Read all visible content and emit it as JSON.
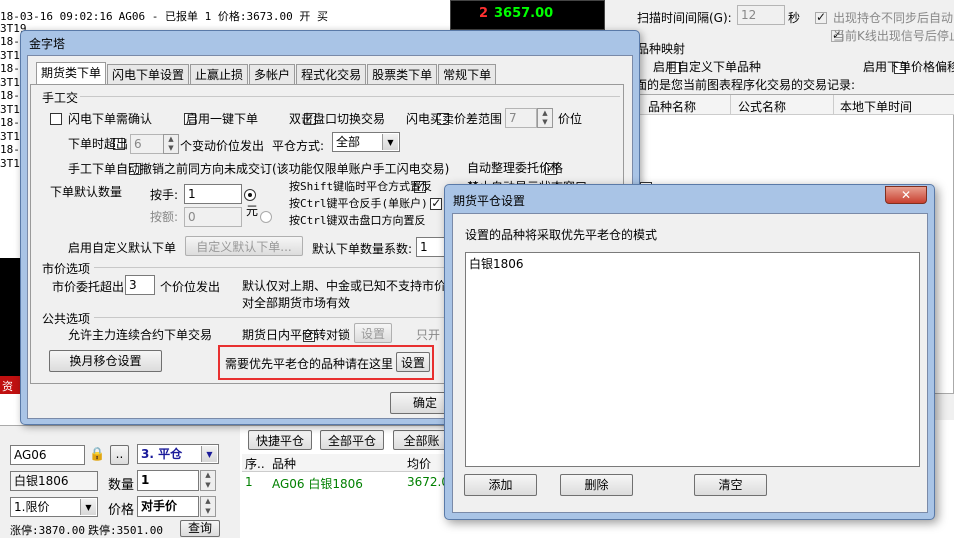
{
  "background_app": {
    "log_lines": [
      {
        "prefix": "18-03-16 09:02:16",
        "text": "AG06 - 已报单 1 价格:3673.00 开 买"
      },
      {
        "prefix": "3T19",
        "text": ""
      },
      {
        "prefix": "18-0",
        "text": ""
      },
      {
        "prefix": "3T19",
        "text": ""
      },
      {
        "prefix": "18-0",
        "text": ""
      },
      {
        "prefix": "3T19",
        "text": ""
      },
      {
        "prefix": "18-0",
        "text": ""
      },
      {
        "prefix": "3T19",
        "text": ""
      },
      {
        "prefix": "18-0",
        "text": ""
      },
      {
        "prefix": "3T19",
        "text": ""
      },
      {
        "prefix": "18-0",
        "text": ""
      },
      {
        "prefix": "3T19",
        "text": ""
      }
    ],
    "quote": {
      "index": "2",
      "price": "3657.00",
      "price2": "3657.00"
    },
    "right_panel": {
      "scan_interval_label": "扫描时间间隔(G):",
      "scan_interval_value": "12",
      "scan_interval_unit": "秒",
      "sync_warning_label": "出现持仓不同步后自动",
      "stop_signal_label": "当前K线出现信号后停止",
      "mapping_title": "品种映射",
      "custom_variety_label": "启用自定义下单品种",
      "custom_price_label": "启用下单价格偏移",
      "record_desc": "面的是您当前图表程序化交易的交易记录:",
      "table_headers": [
        "品种名称",
        "公式名称",
        "本地下单时间"
      ]
    },
    "order_panel": {
      "symbol": "AG06",
      "more_label": "..",
      "action": "3. 平仓",
      "variety_name": "白银1806",
      "qty_label": "数量",
      "qty_value": "1",
      "order_type": "1.限价",
      "price_label": "价格",
      "price_value": "对手价",
      "limit_up": "涨停:3870.00",
      "limit_down": "跌停:3501.00",
      "query_label": "查询"
    },
    "positions": {
      "quick_close_label": "快捷平仓",
      "close_all_label": "全部平仓",
      "cancel_all_label": "全部账",
      "headers": [
        "序..",
        "品种",
        "均价"
      ],
      "rows": [
        {
          "seq": "1",
          "name": "AG06 白银1806",
          "avg": "3672.0"
        }
      ]
    },
    "side_label": "资"
  },
  "main_dialog": {
    "title": "金字塔",
    "tabs": [
      "期货类下单",
      "闪电下单设置",
      "止赢止损",
      "多帐户",
      "程式化交易",
      "股票类下单",
      "常规下单"
    ],
    "manual_section": "手工交",
    "lightning_confirm": "闪电下单需确认",
    "one_click": "启用一键下单",
    "dblclick_switch": "双击盘口切换交易",
    "lightning_range": "闪电买卖价差范围",
    "range_value": "7",
    "range_unit": "价位",
    "order_exceed": "下单时超出",
    "exceed_value": "6",
    "exceed_suffix": "个变动价位发出",
    "close_mode_label": "平仓方式:",
    "close_mode_value": "全部",
    "auto_cancel": "手工下单自动撤销之前同方向未成交订(该功能仅限单账户手工闪电交易)",
    "auto_arrange": "自动整理委托价格",
    "default_qty_label": "下单默认数量",
    "by_lots_label": "按手:",
    "lots_value": "1",
    "by_amount_label": "按额:",
    "amount_value": "0",
    "amount_unit": "元",
    "shift_reverse": "按Shift键临时平仓方式置反",
    "ctrl_reverse": "按Ctrl键平仓反手(单账户)",
    "ctrl_dbl": "按Ctrl键双击盘口方向置反",
    "hidden_row": "禁止自动显示状态窗口",
    "custom_default_qty": "启用自定义默认下单",
    "custom_default_btn": "自定义默认下单...",
    "qty_coefficient_label": "默认下单数量系数:",
    "qty_coefficient_value": "1",
    "market_section": "市价选项",
    "market_exceed": "市价委托超出",
    "market_exceed_value": "3",
    "market_exceed_suffix": "个价位发出",
    "market_default_radio": "默认仅对上期、中金或已知不支持市价",
    "market_all_radio": "对全部期货市场有效",
    "public_section": "公共选项",
    "allow_rollover": "允许主力连续合约下单交易",
    "intraday_lock": "期货日内平仓转对锁",
    "setting_label": "设置",
    "only_open_label": "只开",
    "rollover_btn": "换月移仓设置",
    "hint_text": "需要优先平老仓的品种请在这里",
    "hint_setting_btn": "设置",
    "ok_btn": "确定"
  },
  "sub_dialog": {
    "title": "期货平仓设置",
    "close_label": "✕",
    "description": "设置的品种将采取优先平老仓的模式",
    "items": [
      "白银1806"
    ],
    "add_btn": "添加",
    "delete_btn": "删除",
    "clear_btn": "清空"
  },
  "colors": {
    "dark_panel": "#000000",
    "quote_red": "#d00000",
    "quote_green": "#00ff00",
    "position_green": "#008000",
    "highlight_red": "#e83030",
    "dialog_frame": "#a9c4e6"
  }
}
